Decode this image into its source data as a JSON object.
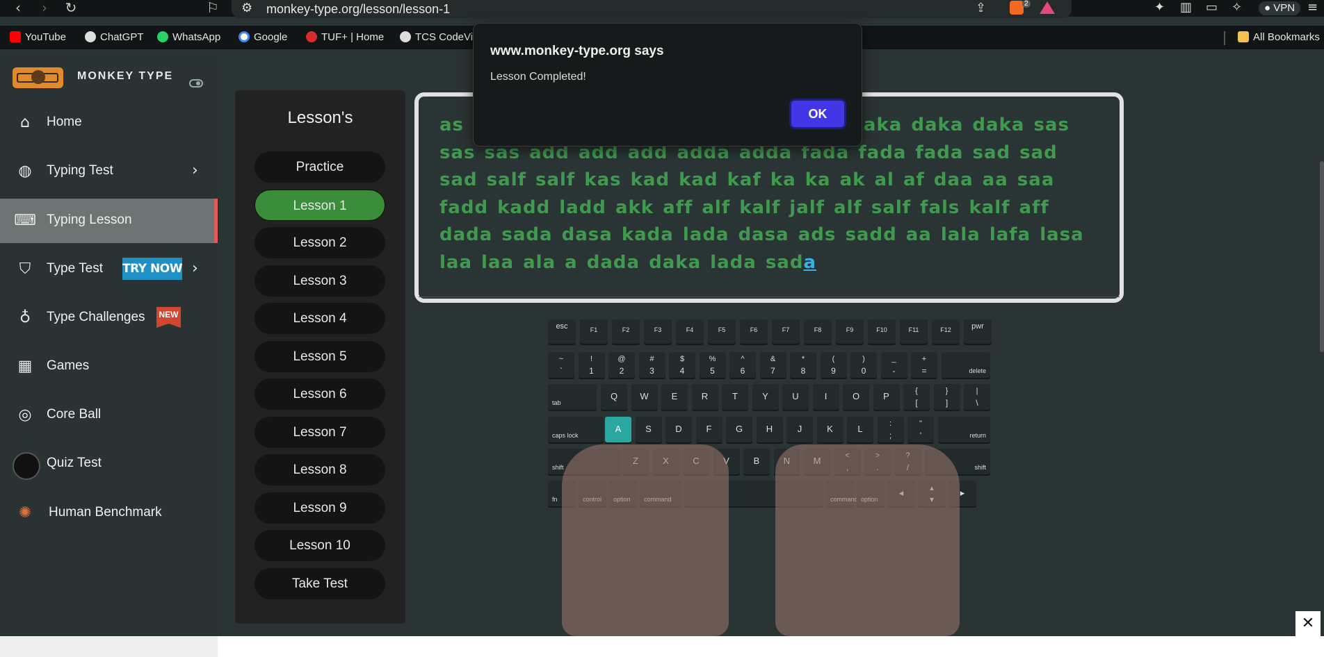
{
  "browser": {
    "url": "monkey-type.org/lesson/lesson-1",
    "brave_badge": "2",
    "vpn_label": "VPN",
    "icons": [
      "back-icon",
      "forward-icon",
      "reload-icon",
      "bookmark-icon",
      "site-settings-icon",
      "share-icon",
      "brave-shield-icon",
      "brave-rewards-icon",
      "extensions-icon",
      "sidebar-icon",
      "wallet-icon",
      "leo-icon",
      "menu-icon"
    ]
  },
  "bookmarks": {
    "items": [
      {
        "label": "YouTube",
        "color": "#ff0000"
      },
      {
        "label": "ChatGPT",
        "color": "#e0e0e0"
      },
      {
        "label": "WhatsApp",
        "color": "#25d366"
      },
      {
        "label": "Google",
        "color": "#4285f4"
      },
      {
        "label": "TUF+ | Home",
        "color": "#d92b2b"
      },
      {
        "label": "TCS CodeVi",
        "color": "#e0e0e0"
      }
    ],
    "all_bookmarks": "All Bookmarks"
  },
  "sidebar": {
    "brand": "MONKEY TYPE",
    "items": [
      {
        "label": "Home",
        "icon": "home-icon"
      },
      {
        "label": "Typing Test",
        "icon": "github-icon"
      },
      {
        "label": "Typing Lesson",
        "icon": "keyboard-icon"
      },
      {
        "label": "Type Test",
        "icon": "gitlab-icon",
        "badge": "TRY NOW"
      },
      {
        "label": "Type Challenges",
        "icon": "award-icon",
        "badge": "NEW"
      },
      {
        "label": "Games",
        "icon": "grid-icon"
      },
      {
        "label": "Core Ball",
        "icon": "target-icon"
      },
      {
        "label": "Quiz Test",
        "icon": "quiz-avatar-icon"
      },
      {
        "label": "Human Benchmark",
        "icon": "benchmark-icon"
      }
    ]
  },
  "lessons": {
    "title": "Lesson's",
    "items": [
      "Practice",
      "Lesson 1",
      "Lesson 2",
      "Lesson 3",
      "Lesson 4",
      "Lesson 5",
      "Lesson 6",
      "Lesson 7",
      "Lesson 8",
      "Lesson 9",
      "Lesson 10",
      "Take Test"
    ],
    "active": "Lesson 1"
  },
  "lesson_text": {
    "typed": "as a d lala lala lala dada dada dada daka daka daka sas sas sas add add add adda adda fada fada fada sad sad sad salf salf kas kad kad kaf ka ka ak al af daa aa saa fadd kadd ladd akk aff alf kalf jalf alf salf fals kalf aff dada sada dasa kada lada dasa ads sadd aa lala lafa lasa laa laa ala a dada daka lada sad",
    "current": "a"
  },
  "keyboard": {
    "highlighted_key": "A",
    "row0": [
      "esc",
      "F1",
      "F2",
      "F3",
      "F4",
      "F5",
      "F6",
      "F7",
      "F8",
      "F9",
      "F10",
      "F11",
      "F12",
      "pwr"
    ],
    "row1": [
      [
        "~",
        "`"
      ],
      [
        "!",
        "1"
      ],
      [
        "@",
        "2"
      ],
      [
        "#",
        "3"
      ],
      [
        "$",
        "4"
      ],
      [
        "%",
        "5"
      ],
      [
        "^",
        "6"
      ],
      [
        "&",
        "7"
      ],
      [
        "*",
        "8"
      ],
      [
        "(",
        "9"
      ],
      [
        ")",
        "0"
      ],
      [
        "_",
        "-"
      ],
      [
        "+",
        "="
      ]
    ],
    "row1_end": "delete",
    "row2_start": "tab",
    "row2": [
      "Q",
      "W",
      "E",
      "R",
      "T",
      "Y",
      "U",
      "I",
      "O",
      "P"
    ],
    "row2_sym": [
      [
        "{",
        "["
      ],
      [
        "}",
        "]"
      ],
      [
        "|",
        "\\"
      ]
    ],
    "row3_start": "caps lock",
    "row3": [
      "A",
      "S",
      "D",
      "F",
      "G",
      "H",
      "J",
      "K",
      "L"
    ],
    "row3_sym": [
      [
        ":",
        ";"
      ],
      [
        "\"",
        "'"
      ]
    ],
    "row3_end": "return",
    "row4_start": "shift",
    "row4": [
      "Z",
      "X",
      "C",
      "V",
      "B",
      "N",
      "M"
    ],
    "row4_sym": [
      [
        "<",
        ","
      ],
      [
        ">",
        "."
      ],
      [
        "?",
        "/"
      ]
    ],
    "row4_end": "shift",
    "row5": [
      "fn",
      "control",
      "option",
      "command",
      "command",
      "option"
    ]
  },
  "dialog": {
    "title": "www.monkey-type.org says",
    "message": "Lesson Completed!",
    "ok_label": "OK"
  },
  "close_label": "✕"
}
